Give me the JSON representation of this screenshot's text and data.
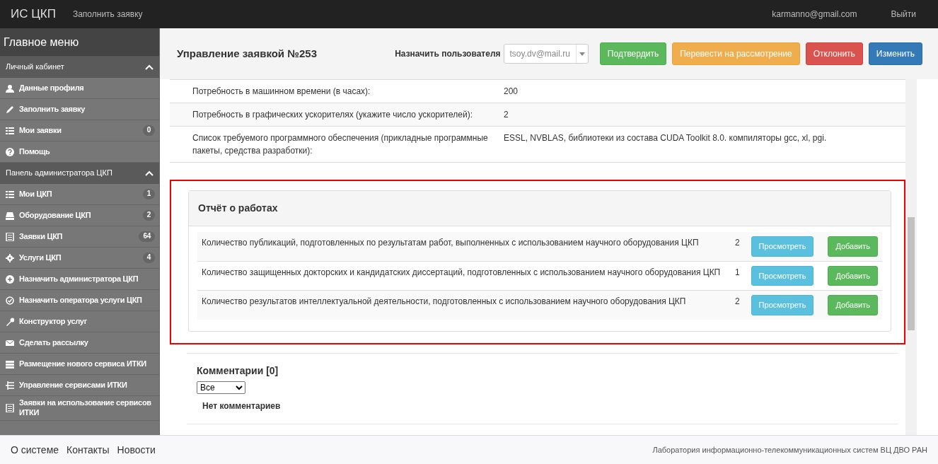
{
  "navbar": {
    "brand": "ИС ЦКП",
    "link": "Заполнить заявку",
    "user_email": "karmanno@gmail.com",
    "logout": "Выйти"
  },
  "sidebar": {
    "title": "Главное меню",
    "sections": [
      {
        "title": "Личный кабинет",
        "expanded": true,
        "items": [
          {
            "label": "Данные профиля"
          },
          {
            "label": "Заполнить заявку"
          },
          {
            "label": "Мои заявки",
            "badge": "0"
          },
          {
            "label": "Помощь"
          }
        ]
      },
      {
        "title": "Панель администратора ЦКП",
        "expanded": true,
        "items": [
          {
            "label": "Мои ЦКП",
            "badge": "1"
          },
          {
            "label": "Оборудование ЦКП",
            "badge": "2"
          },
          {
            "label": "Заявки ЦКП",
            "badge": "64"
          },
          {
            "label": "Услуги ЦКП",
            "badge": "4"
          },
          {
            "label": "Назначить администратора ЦКП"
          },
          {
            "label": "Назначить оператора услуги ЦКП"
          },
          {
            "label": "Конструктор услуг"
          },
          {
            "label": "Сделать рассылку"
          },
          {
            "label": "Размещение нового сервиса ИТКИ"
          },
          {
            "label": "Управление сервисами ИТКИ"
          },
          {
            "label": "Заявки на использование сервисов ИТКИ"
          }
        ]
      }
    ]
  },
  "header": {
    "title": "Управление заявкой №253",
    "assign_label": "Назначить пользователя",
    "assign_value": "tsoy.dv@mail.ru",
    "buttons": [
      {
        "label": "Подтвердить",
        "kind": "success"
      },
      {
        "label": "Перевести на рассмотрение",
        "kind": "warning"
      },
      {
        "label": "Отклонить",
        "kind": "danger"
      },
      {
        "label": "Изменить",
        "kind": "primary"
      }
    ]
  },
  "details": [
    {
      "label": "Потребность в машинном времени (в часах):",
      "value": "200"
    },
    {
      "label": "Потребность в графических ускорителях (укажите число ускорителей):",
      "value": "2"
    },
    {
      "label": "Список требуемого программного обеспечения (прикладные программные пакеты, средства разработки):",
      "value": "ESSL, NVBLAS, библиотеки из состава CUDA Toolkit 8.0. компиляторы gcc, xl, pgi."
    }
  ],
  "report": {
    "title": "Отчёт о работах",
    "highlighted": true,
    "rows": [
      {
        "text": "Количество публикаций, подготовленных по результатам работ, выполненных с использованием научного оборудования ЦКП",
        "count": "2",
        "view": "Просмотреть",
        "add": "Добавить"
      },
      {
        "text": "Количество защищенных докторских и кандидатских диссертаций, подготовленных с использованием научного оборудования ЦКП",
        "count": "1",
        "view": "Просмотреть",
        "add": "Добавить"
      },
      {
        "text": "Количество результатов интеллектуальной деятельности, подготовленных с использованием научного оборудования ЦКП",
        "count": "2",
        "view": "Просмотреть",
        "add": "Добавить"
      }
    ]
  },
  "comments": {
    "title": "Комментарии [0]",
    "filter": "Все",
    "empty": "Нет комментариев"
  },
  "footer": {
    "links": [
      "О системе",
      "Контакты",
      "Новости"
    ],
    "credit": "Лаборатория информационно-телекоммуникационных систем ВЦ ДВО РАН"
  }
}
